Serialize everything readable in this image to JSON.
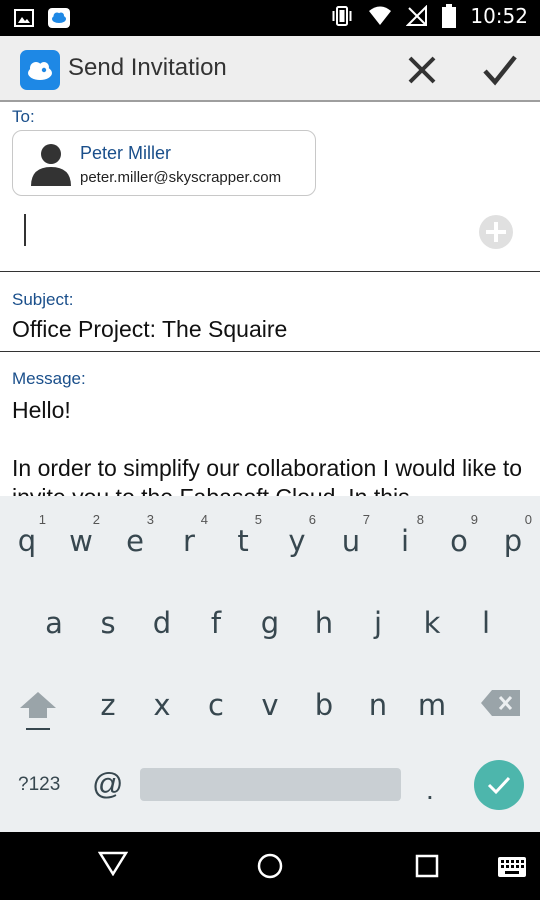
{
  "status_bar": {
    "time": "10:52",
    "icons": [
      "image-notification-icon",
      "cloud-app-notification-icon",
      "vibrate-icon",
      "wifi-icon",
      "no-signal-icon",
      "battery-icon"
    ]
  },
  "app_bar": {
    "title": "Send Invitation",
    "icons": [
      "cloud-logo-icon",
      "close-icon",
      "checkmark-icon"
    ]
  },
  "form": {
    "to_label": "To:",
    "recipient": {
      "name": "Peter Miller",
      "email": "peter.miller@skyscrapper.com"
    },
    "subject_label": "Subject:",
    "subject_value": "Office Project: The Squaire",
    "message_label": "Message:",
    "message_value": "Hello!\n\nIn order to simplify our collaboration I would like to invite you to the Fabasoft Cloud. In this"
  },
  "keyboard": {
    "row1": [
      {
        "ch": "q",
        "hint": "1"
      },
      {
        "ch": "w",
        "hint": "2"
      },
      {
        "ch": "e",
        "hint": "3"
      },
      {
        "ch": "r",
        "hint": "4"
      },
      {
        "ch": "t",
        "hint": "5"
      },
      {
        "ch": "y",
        "hint": "6"
      },
      {
        "ch": "u",
        "hint": "7"
      },
      {
        "ch": "i",
        "hint": "8"
      },
      {
        "ch": "o",
        "hint": "9"
      },
      {
        "ch": "p",
        "hint": "0"
      }
    ],
    "row2": [
      "a",
      "s",
      "d",
      "f",
      "g",
      "h",
      "j",
      "k",
      "l"
    ],
    "row3": [
      "z",
      "x",
      "c",
      "v",
      "b",
      "n",
      "m"
    ],
    "mode_label": "?123",
    "at_label": "@",
    "period_label": ".",
    "accent_color": "#4db6ac"
  },
  "nav_bar": {
    "icons": [
      "back-icon",
      "home-icon",
      "recents-icon",
      "keyboard-switch-icon"
    ]
  }
}
